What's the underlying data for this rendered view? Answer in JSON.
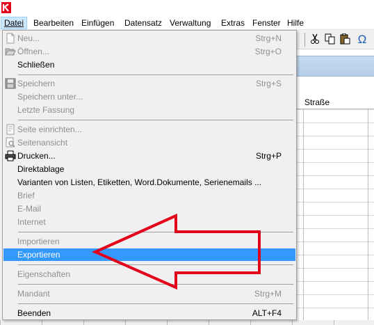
{
  "menubar": {
    "items": [
      {
        "label": "Datei",
        "active": true
      },
      {
        "label": "Bearbeiten"
      },
      {
        "label": "Einfügen"
      },
      {
        "label": "Datensatz"
      },
      {
        "label": "Verwaltung"
      },
      {
        "label": "Extras"
      },
      {
        "label": "Fenster"
      },
      {
        "label": "Hilfe"
      }
    ]
  },
  "toolbar": {
    "icons": [
      "scissors-icon",
      "copy-icon",
      "paste-icon",
      "omega-icon"
    ],
    "omega_glyph": "Ω"
  },
  "grid": {
    "column_header": "Straße"
  },
  "menu": {
    "items": [
      {
        "label": "Neu...",
        "shortcut": "Strg+N",
        "disabled": true,
        "icon": "new-document-icon"
      },
      {
        "label": "Öffnen...",
        "shortcut": "Strg+O",
        "disabled": true,
        "icon": "open-folder-icon"
      },
      {
        "label": "Schließen",
        "shortcut": "",
        "disabled": false
      },
      {
        "label": "Speichern",
        "shortcut": "Strg+S",
        "disabled": true,
        "icon": "save-icon"
      },
      {
        "label": "Speichern unter...",
        "shortcut": "",
        "disabled": true
      },
      {
        "label": "Letzte Fassung",
        "shortcut": "",
        "disabled": true
      },
      {
        "label": "Seite einrichten...",
        "shortcut": "",
        "disabled": true,
        "icon": "page-setup-icon"
      },
      {
        "label": "Seitenansicht",
        "shortcut": "",
        "disabled": true,
        "icon": "print-preview-icon"
      },
      {
        "label": "Drucken...",
        "shortcut": "Strg+P",
        "disabled": false,
        "icon": "printer-icon"
      },
      {
        "label": "Direktablage",
        "shortcut": "",
        "disabled": false
      },
      {
        "label": "Varianten von Listen, Etiketten, Word.Dokumente, Serienemails ...",
        "shortcut": "",
        "disabled": false
      },
      {
        "label": "Brief",
        "shortcut": "",
        "disabled": true
      },
      {
        "label": "E-Mail",
        "shortcut": "",
        "disabled": true
      },
      {
        "label": "Internet",
        "shortcut": "",
        "disabled": true
      },
      {
        "label": "Importieren",
        "shortcut": "",
        "disabled": true
      },
      {
        "label": "Exportieren",
        "shortcut": "",
        "disabled": false,
        "highlighted": true
      },
      {
        "label": "Eigenschaften",
        "shortcut": "",
        "disabled": true
      },
      {
        "label": "Mandant",
        "shortcut": "Strg+M",
        "disabled": true
      },
      {
        "label": "Beenden",
        "shortcut": "ALT+F4",
        "disabled": false
      }
    ]
  },
  "colors": {
    "menu_bg": "#f0f0f0",
    "highlight": "#3399ff",
    "disabled_text": "#8f8f8f",
    "arrow": "#e2001a",
    "menubar_active": "#cce8ff"
  }
}
